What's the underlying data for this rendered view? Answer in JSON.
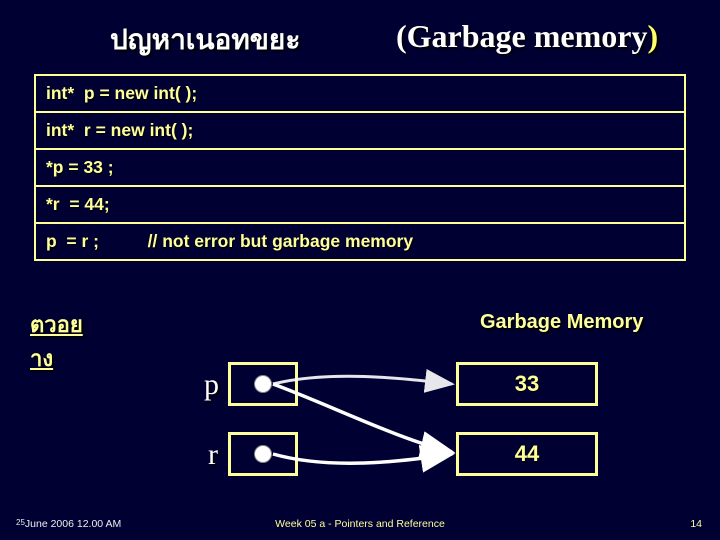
{
  "title": {
    "thai": "ปญหาเนอทขยะ",
    "en_open": "(Garbage memory",
    "en_close": ")"
  },
  "code": {
    "l1": "int*  p = new int( );",
    "l2": "int*  r = new int( );",
    "l3": "*p = 33 ;",
    "l4": "*r  = 44;",
    "l5_a": "p  = r ;",
    "l5_b": "// not error but garbage memory"
  },
  "labels": {
    "example_thai_l1": "ตวอย",
    "example_thai_l2": "าง",
    "garbage": "Garbage Memory",
    "p": "p",
    "r": "r",
    "v33": "33",
    "v44": "44"
  },
  "footer": {
    "left_small": "25",
    "left_rest": "June 2006  12.00 AM",
    "center": "Week 05 a - Pointers and Reference",
    "right": "14"
  }
}
